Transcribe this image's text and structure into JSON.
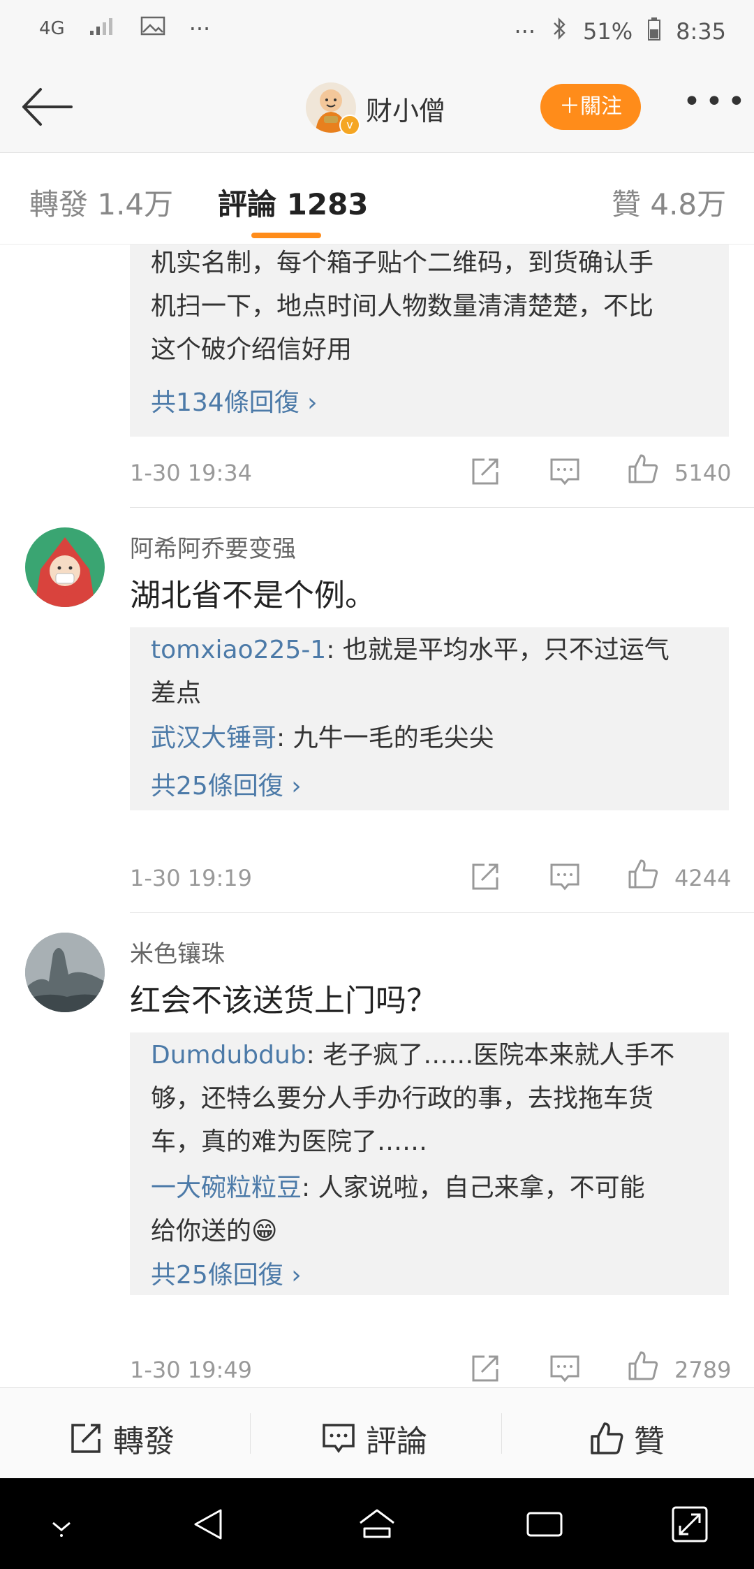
{
  "status_bar": {
    "signal": "4G",
    "dots_left": "···",
    "dots_right": "···",
    "battery": "51%",
    "time": "8:35"
  },
  "nav": {
    "title": "财小僧",
    "follow_label": "＋關注",
    "more": "•••",
    "verified": "v"
  },
  "tabs": {
    "repost": "轉發 1.4万",
    "comments": "評論 1283",
    "likes": "贊 4.8万"
  },
  "comments": [
    {
      "reply_lines": [
        "机实名制，每个箱子贴个二维码，到货确认手",
        "机扫一下，地点时间人物数量清清楚楚，不比",
        "这个破介绍信好用"
      ],
      "more_replies": "共134條回復 ›",
      "time": "1-30 19:34",
      "likes": "5140"
    },
    {
      "user": "阿希阿乔要变强",
      "text": "湖北省不是个例。",
      "replies": [
        {
          "name": "tomxiao225-1",
          "line1": ": 也就是平均水平，只不过运气",
          "line2": "差点"
        },
        {
          "name": "武汉大锤哥",
          "line1": ": 九牛一毛的毛尖尖"
        }
      ],
      "more_replies": "共25條回復 ›",
      "time": "1-30 19:19",
      "likes": "4244"
    },
    {
      "user": "米色镶珠",
      "text": "红会不该送货上门吗？",
      "replies": [
        {
          "name": "Dumdubdub",
          "line1": ": 老子疯了……医院本来就人手不",
          "line2": "够，还特么要分人手办行政的事，去找拖车货",
          "line3": "车，真的难为医院了……"
        },
        {
          "name": "一大碗粒粒豆",
          "line1": ": 人家说啦，自己来拿，不可能",
          "line2": "给你送的😁"
        }
      ],
      "more_replies": "共25條回復 ›",
      "time": "1-30 19:49",
      "likes": "2789"
    }
  ],
  "bottom_bar": {
    "repost": "轉發",
    "comment": "評論",
    "like": "贊"
  }
}
